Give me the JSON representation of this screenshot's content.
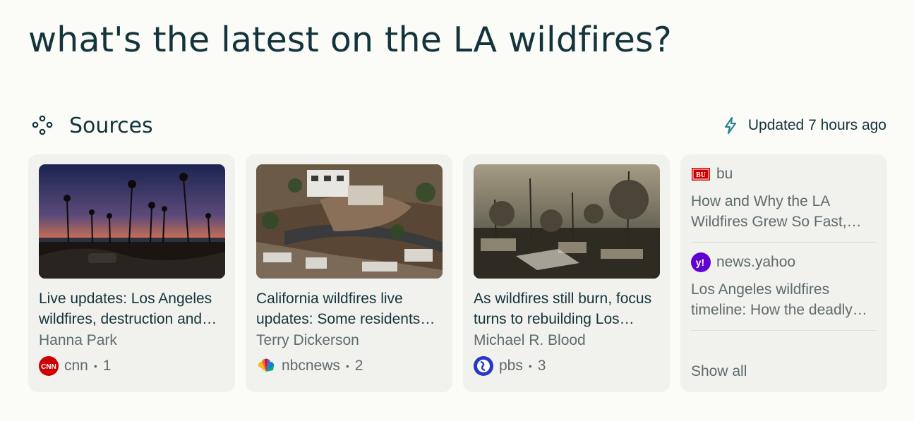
{
  "query": "what's the latest on the LA wildfires?",
  "sources": {
    "title": "Sources",
    "updated": "Updated 7 hours ago",
    "cards": [
      {
        "title": "Live updates: Los Angeles wildfires, destruction and evacuations",
        "author": "Hanna Park",
        "site": "cnn",
        "index": "1",
        "icon": "cnn-favicon-icon"
      },
      {
        "title": "California wildfires live updates: Some residents return",
        "author": "Terry Dickerson",
        "site": "nbcnews",
        "index": "2",
        "icon": "nbc-peacock-icon"
      },
      {
        "title": "As wildfires still burn, focus turns to rebuilding Los Angeles",
        "author": "Michael R. Blood",
        "site": "pbs",
        "index": "3",
        "icon": "pbs-favicon-icon"
      }
    ],
    "side": [
      {
        "site": "bu",
        "title": "How and Why the LA Wildfires Grew So Fast, Explained",
        "icon": "bu-favicon-icon"
      },
      {
        "site": "news.yahoo",
        "title": "Los Angeles wildfires timeline: How the deadly fires unfolded",
        "icon": "yahoo-favicon-icon"
      }
    ],
    "show_all": "Show all"
  },
  "colors": {
    "background": "#fbfbf7",
    "card": "#f1f1ed",
    "text": "#13343b",
    "muted": "#5f6b6d",
    "accent": "#20808d"
  }
}
